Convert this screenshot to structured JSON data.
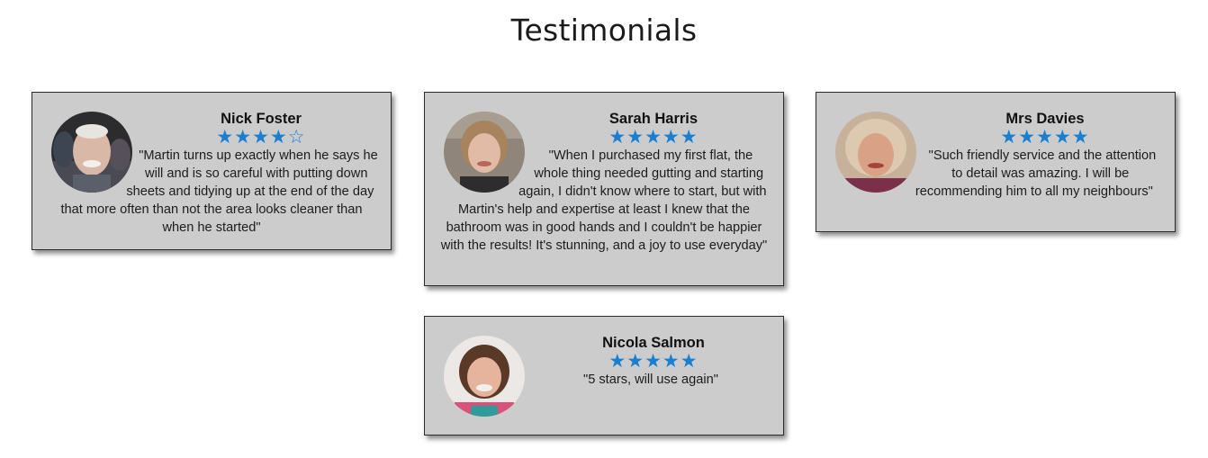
{
  "page": {
    "title": "Testimonials"
  },
  "colors": {
    "card_background": "#cccccc",
    "star_color": "#1a7fd1"
  },
  "testimonials": [
    {
      "name": "Nick Foster",
      "rating": 4,
      "max_rating": 5,
      "quote": "\"Martin turns up exactly when he says he will and is so careful with putting down sheets and tidying up at the end of the day that more often than not the area looks cleaner than when he started\""
    },
    {
      "name": "Sarah Harris",
      "rating": 5,
      "max_rating": 5,
      "quote": "\"When I purchased my first flat, the whole thing needed gutting and starting again, I didn't know where to start, but with Martin's help and expertise at least I knew that the bathroom was in good hands and I couldn't be happier with the results! It's stunning, and a joy to use everyday\""
    },
    {
      "name": "Mrs Davies",
      "rating": 5,
      "max_rating": 5,
      "quote": "\"Such friendly service and the attention to detail was amazing. I will be recommending him to all my neighbours\""
    },
    {
      "name": "Nicola Salmon",
      "rating": 5,
      "max_rating": 5,
      "quote": "\"5 stars, will use again\""
    }
  ],
  "icons": {
    "filled_star": "star-filled-icon",
    "empty_star": "star-outline-icon"
  }
}
